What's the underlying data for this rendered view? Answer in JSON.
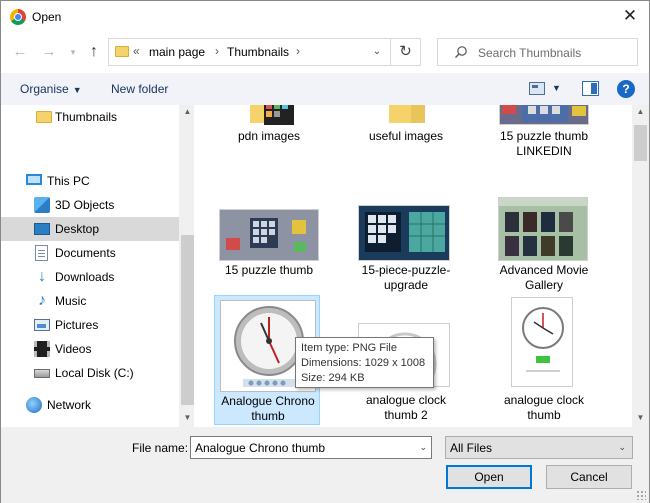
{
  "window": {
    "title": "Open",
    "app_icon": "chrome-icon",
    "close_label": "✕"
  },
  "nav": {
    "back_icon": "back-arrow-icon",
    "forward_icon": "forward-arrow-icon",
    "recent_icon": "chevron-down-icon",
    "up_icon": "up-arrow-icon",
    "breadcrumb": [
      "main page",
      "Thumbnails"
    ],
    "overflow_label": "«",
    "search_placeholder": "Search Thumbnails"
  },
  "toolbar": {
    "organise_label": "Organise",
    "new_folder_label": "New folder",
    "help_label": "?"
  },
  "sidebar": {
    "items": [
      {
        "label": "Thumbnails",
        "icon": "folder-icon",
        "selected": false
      },
      {
        "label": "This PC",
        "icon": "pc-icon",
        "selected": false
      },
      {
        "label": "3D Objects",
        "icon": "3d-objects-icon",
        "selected": false
      },
      {
        "label": "Desktop",
        "icon": "desktop-icon",
        "selected": true
      },
      {
        "label": "Documents",
        "icon": "documents-icon",
        "selected": false
      },
      {
        "label": "Downloads",
        "icon": "downloads-icon",
        "selected": false
      },
      {
        "label": "Music",
        "icon": "music-icon",
        "selected": false
      },
      {
        "label": "Pictures",
        "icon": "pictures-icon",
        "selected": false
      },
      {
        "label": "Videos",
        "icon": "videos-icon",
        "selected": false
      },
      {
        "label": "Local Disk (C:)",
        "icon": "local-disk-icon",
        "selected": false
      },
      {
        "label": "Network",
        "icon": "network-icon",
        "selected": false
      }
    ]
  },
  "files": [
    {
      "name": "pdn images",
      "type": "folder"
    },
    {
      "name": "useful images",
      "type": "folder"
    },
    {
      "name": "15 puzzle thumb LINKEDIN",
      "type": "image"
    },
    {
      "name": "15 puzzle thumb",
      "type": "image"
    },
    {
      "name": "15-piece-puzzle-upgrade",
      "type": "image"
    },
    {
      "name": "Advanced Movie Gallery",
      "type": "image"
    },
    {
      "name": "Analogue Chrono thumb",
      "type": "image",
      "selected": true
    },
    {
      "name": "analogue clock thumb 2",
      "type": "image"
    },
    {
      "name": "analogue clock thumb",
      "type": "image"
    }
  ],
  "tooltip": {
    "line1": "Item type: PNG File",
    "line2": "Dimensions: 1029 x 1008",
    "line3": "Size: 294 KB"
  },
  "footer": {
    "file_name_label": "File name:",
    "file_name_value": "Analogue Chrono thumb",
    "file_type_value": "All Files",
    "open_label": "Open",
    "cancel_label": "Cancel"
  },
  "colors": {
    "accent": "#0078d7",
    "selection": "#cce8ff",
    "toolbar_bg": "#f1f3f8",
    "link_text": "#1a3560"
  }
}
